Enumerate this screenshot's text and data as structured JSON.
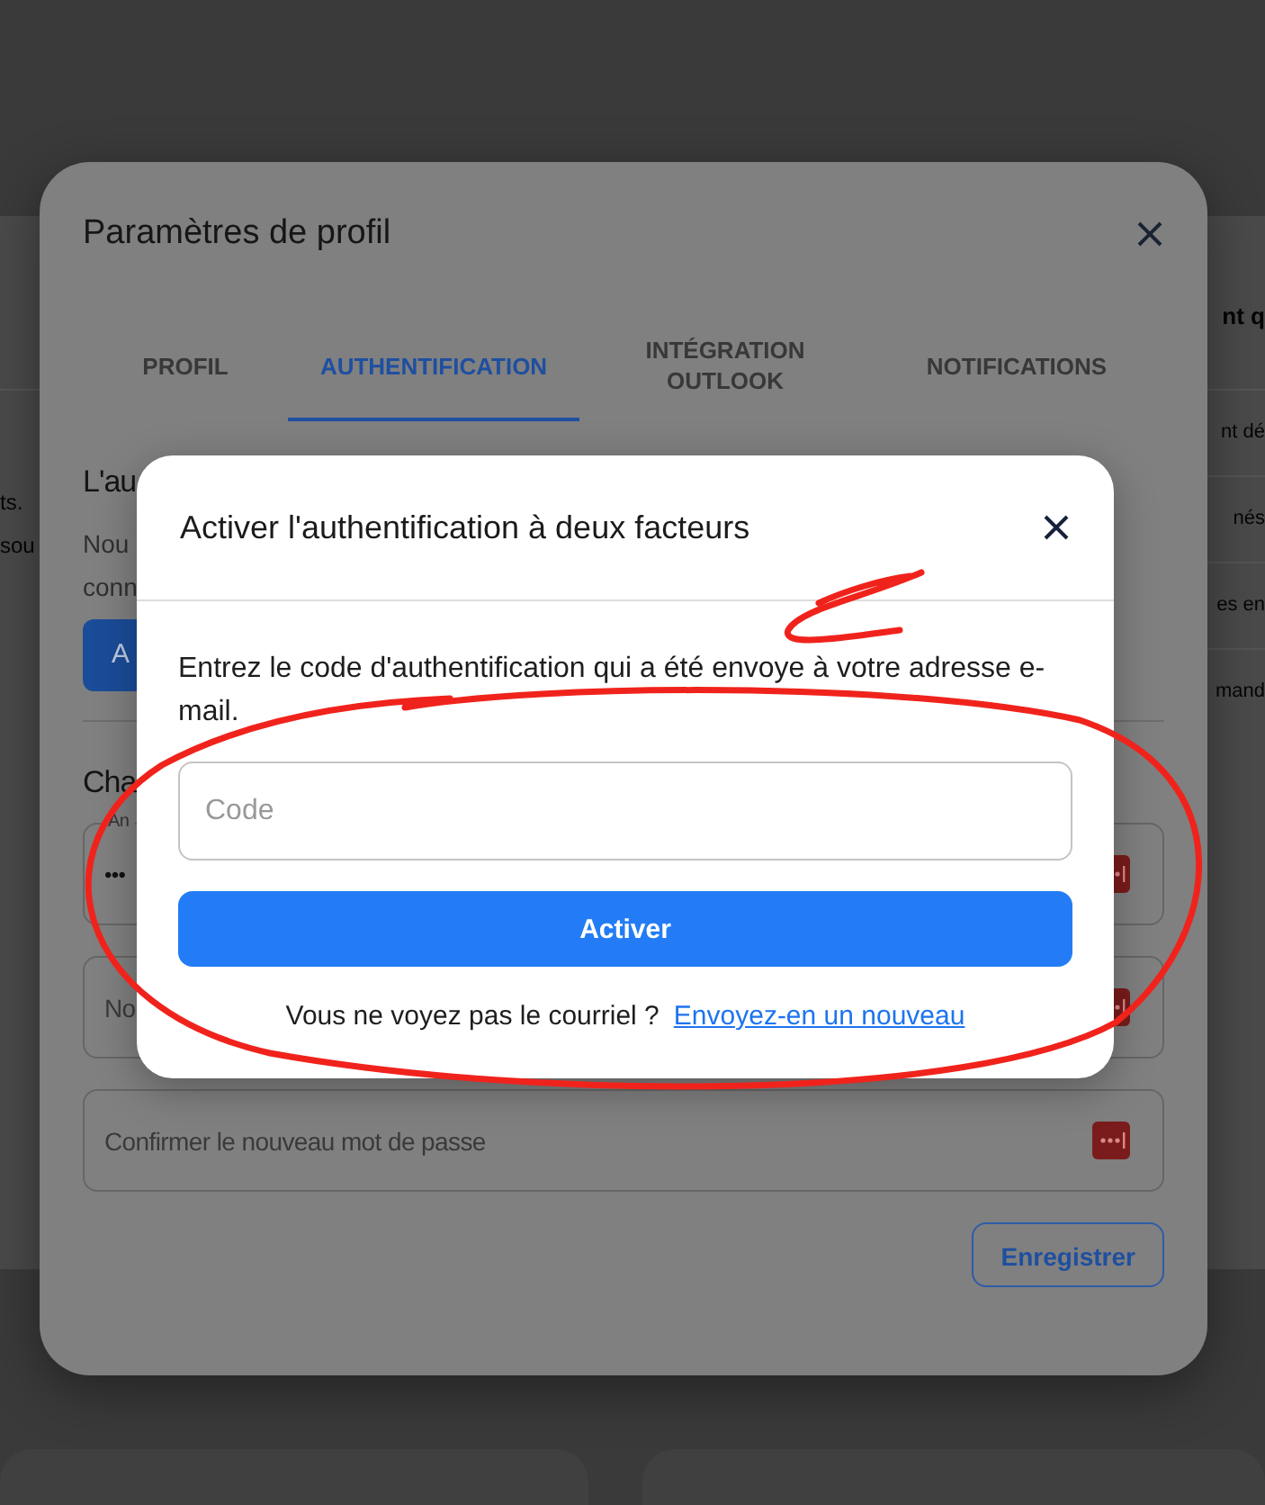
{
  "background": {
    "left_fragments": [
      "ts.",
      "sou"
    ],
    "right_heading": "nt q",
    "right_rows": [
      "nt dé",
      "nés",
      "es en",
      "mand"
    ]
  },
  "profile_dialog": {
    "title": "Paramètres de profil",
    "tabs": [
      {
        "label": "PROFIL",
        "selected": false
      },
      {
        "label": "AUTHENTIFICATION",
        "selected": true
      },
      {
        "label": "INTÉGRATION OUTLOOK",
        "selected": false
      },
      {
        "label": "NOTIFICATIONS",
        "selected": false
      }
    ],
    "section_1": {
      "heading": "L'au",
      "lines": [
        "Nou",
        "conn"
      ],
      "button": "A"
    },
    "section_2": {
      "heading": "Cha",
      "fields": [
        {
          "label": "An",
          "value": "•••"
        },
        {
          "placeholder": "No"
        },
        {
          "placeholder": "Confirmer le nouveau mot de passe"
        }
      ]
    },
    "save_button": "Enregistrer"
  },
  "two_factor_dialog": {
    "title": "Activer l'authentification à deux facteurs",
    "message": "Entrez le code d'authentification qui a été envoye à votre adresse e-mail.",
    "code_field": {
      "placeholder": "Code"
    },
    "activate_button": "Activer",
    "footer_text": "Vous ne voyez pas le courriel ?",
    "resend_link": "Envoyez-en un nouveau"
  }
}
